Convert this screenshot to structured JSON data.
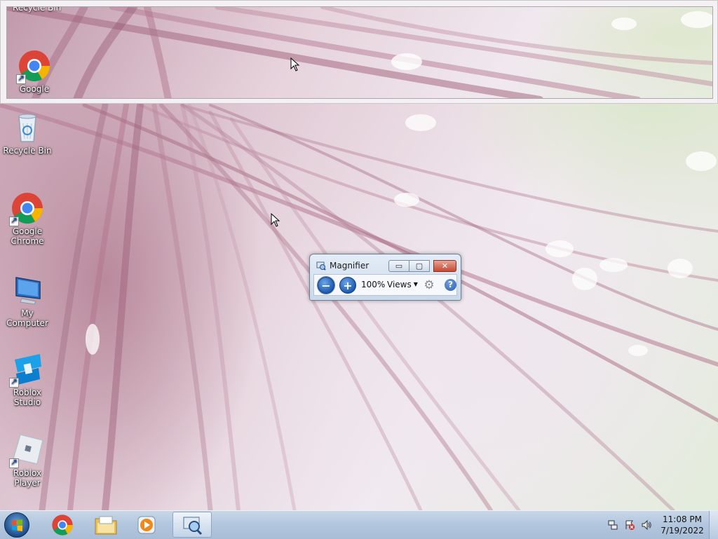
{
  "lens": {
    "partial_label": "Recycle Bin",
    "google_label": "Google"
  },
  "desktop_icons": [
    {
      "label": "Recycle Bin",
      "icon": "recycle-bin-icon"
    },
    {
      "label": "Google Chrome",
      "icon": "chrome-icon"
    },
    {
      "label": "My Computer",
      "icon": "computer-icon"
    },
    {
      "label": "Roblox Studio",
      "icon": "roblox-studio-icon"
    },
    {
      "label": "Roblox Player",
      "icon": "roblox-player-icon"
    }
  ],
  "magnifier": {
    "title": "Magnifier",
    "zoom_level": "100%",
    "views_label": "Views",
    "zoom_out_glyph": "−",
    "zoom_in_glyph": "+",
    "help_glyph": "?",
    "gear_glyph": "⚙",
    "minimize_glyph": "▭",
    "maximize_glyph": "▢",
    "close_glyph": "✕"
  },
  "taskbar": {
    "pinned": [
      {
        "name": "Google Chrome",
        "icon": "chrome-icon"
      },
      {
        "name": "Windows Explorer",
        "icon": "folder-icon"
      },
      {
        "name": "Windows Media Player",
        "icon": "media-player-icon"
      },
      {
        "name": "Magnifier",
        "icon": "magnifier-icon",
        "active": true
      }
    ],
    "clock": {
      "time": "11:08 PM",
      "date": "7/19/2022"
    }
  },
  "colors": {
    "taskbar": "#b3c7de",
    "close_button": "#c54934",
    "zoom_button": "#1d5bb3"
  }
}
